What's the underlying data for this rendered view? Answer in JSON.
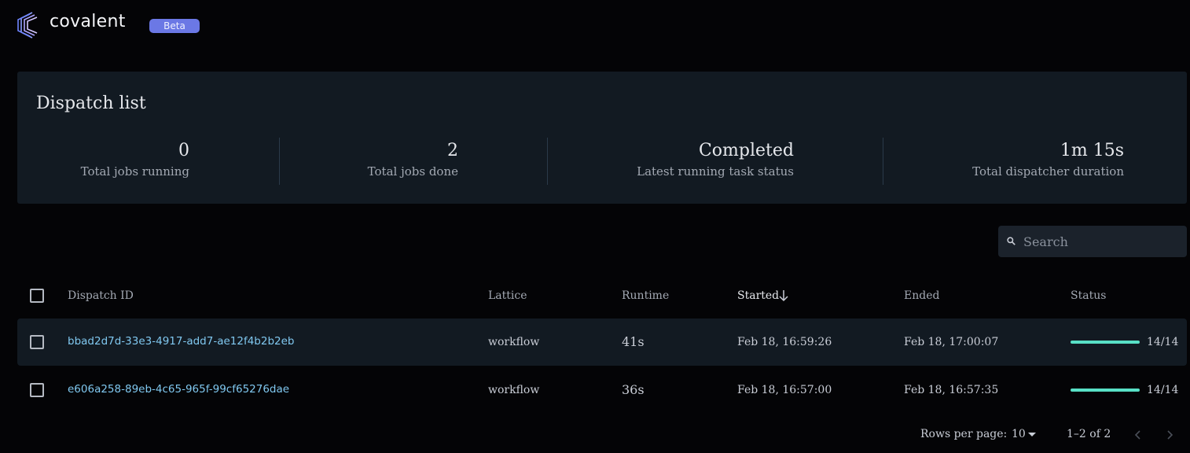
{
  "header": {
    "brand": "covalent",
    "badge": "Beta"
  },
  "summary": {
    "title": "Dispatch list",
    "stats": [
      {
        "value": "0",
        "label": "Total jobs running"
      },
      {
        "value": "2",
        "label": "Total jobs done"
      },
      {
        "value": "Completed",
        "label": "Latest running task status"
      },
      {
        "value": "1m 15s",
        "label": "Total dispatcher duration"
      }
    ]
  },
  "search": {
    "placeholder": "Search",
    "value": ""
  },
  "table": {
    "columns": {
      "dispatch_id": "Dispatch ID",
      "lattice": "Lattice",
      "runtime": "Runtime",
      "started": "Started",
      "ended": "Ended",
      "status": "Status"
    },
    "sorted_by": "Started",
    "sort_direction": "descending",
    "rows": [
      {
        "dispatch_id": "bbad2d7d-33e3-4917-add7-ae12f4b2b2eb",
        "lattice": "workflow",
        "runtime": "41s",
        "started": "Feb 18, 16:59:26",
        "ended": "Feb 18, 17:00:07",
        "status_text": "14/14",
        "progress": 1.0
      },
      {
        "dispatch_id": "e606a258-89eb-4c65-965f-99cf65276dae",
        "lattice": "workflow",
        "runtime": "36s",
        "started": "Feb 18, 16:57:00",
        "ended": "Feb 18, 16:57:35",
        "status_text": "14/14",
        "progress": 1.0
      }
    ]
  },
  "pagination": {
    "rows_label": "Rows per page:",
    "rows_value": "10",
    "range": "1–2 of 2"
  },
  "colors": {
    "accent": "#6b78e5",
    "link": "#80c8f0",
    "progress": "#58e0c6",
    "card": "#121a22"
  },
  "icons": [
    "covalent-logo-icon",
    "search-icon",
    "sort-arrow-down-icon",
    "caret-down-icon",
    "chevron-left-icon",
    "chevron-right-icon"
  ]
}
